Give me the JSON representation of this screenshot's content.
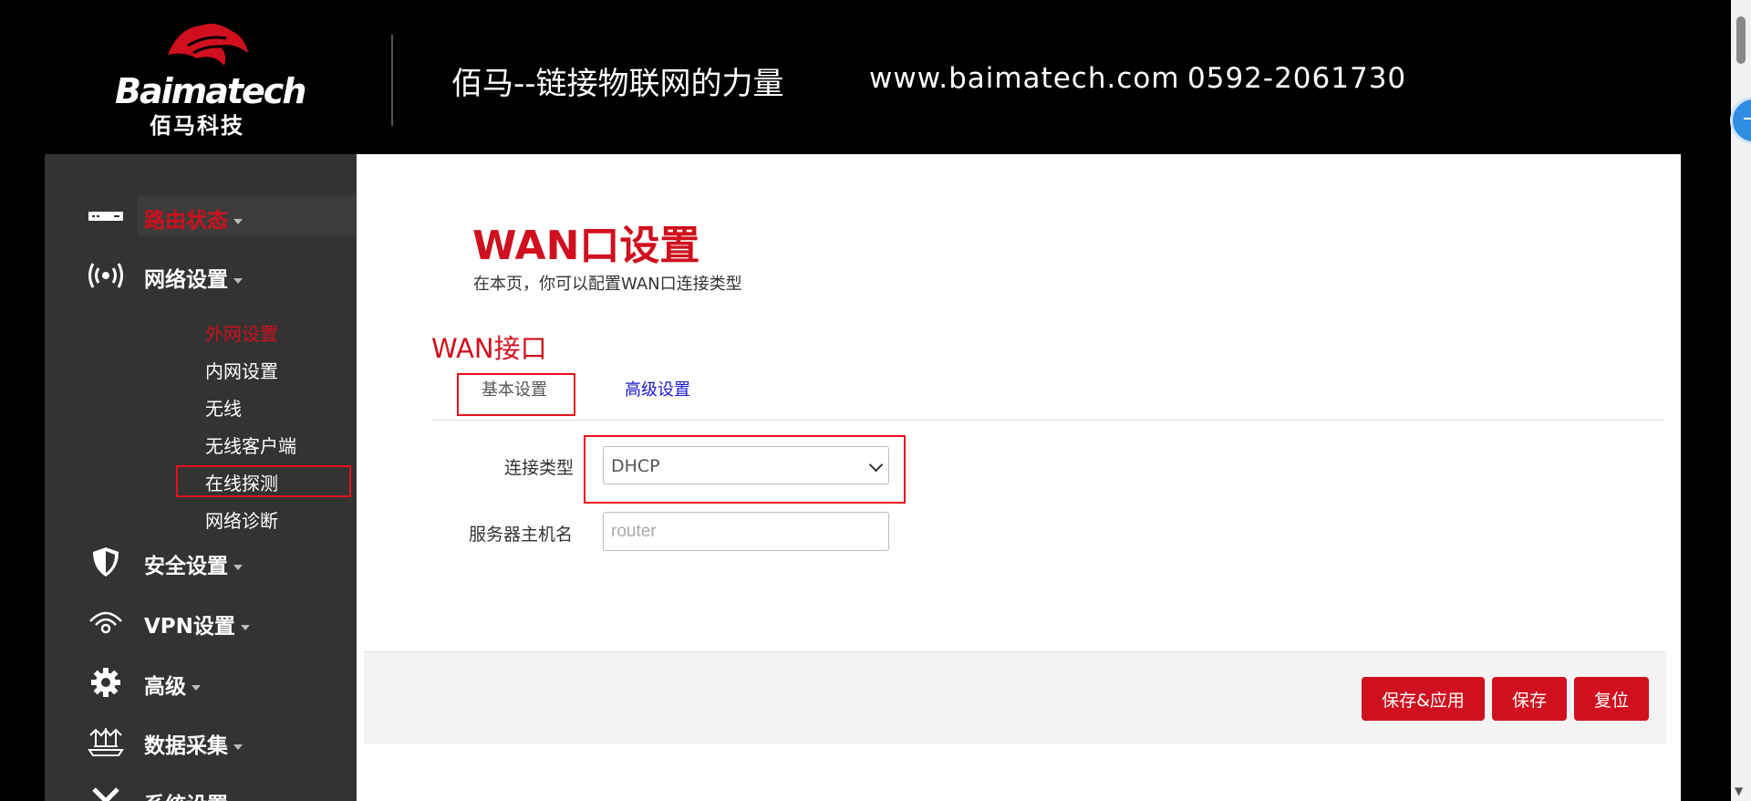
{
  "header": {
    "logo_text": "Baimatech",
    "logo_subtext": "佰马科技",
    "slogan": "佰马--链接物联网的力量",
    "website": "www.baimatech.com",
    "phone": "0592-2061730"
  },
  "sidebar": {
    "groups": [
      {
        "label": "路由状态",
        "icon": "router-icon",
        "active": true
      },
      {
        "label": "网络设置",
        "icon": "broadcast-icon"
      },
      {
        "label": "安全设置",
        "icon": "shield-icon"
      },
      {
        "label": "VPN设置",
        "icon": "vpn-icon"
      },
      {
        "label": "高级",
        "icon": "gear-icon"
      },
      {
        "label": "数据采集",
        "icon": "data-collect-icon"
      },
      {
        "label": "系统设置",
        "icon": "tools-icon"
      }
    ],
    "network_submenu": [
      {
        "label": "外网设置",
        "current": true
      },
      {
        "label": "内网设置"
      },
      {
        "label": "无线"
      },
      {
        "label": "无线客户端"
      },
      {
        "label": "在线探测"
      },
      {
        "label": "网络诊断"
      }
    ]
  },
  "main": {
    "title": "WAN口设置",
    "description": "在本页，你可以配置WAN口连接类型",
    "section_title": "WAN接口",
    "tabs": [
      {
        "label": "基本设置",
        "active": true
      },
      {
        "label": "高级设置"
      }
    ],
    "fields": {
      "connection_type": {
        "label": "连接类型",
        "value": "DHCP"
      },
      "hostname": {
        "label": "服务器主机名",
        "placeholder": "router"
      }
    },
    "buttons": {
      "save_apply": "保存&应用",
      "save": "保存",
      "reset": "复位"
    }
  },
  "colors": {
    "brand_red": "#d0101e",
    "highlight_box": "#e8101e",
    "sidebar_bg": "#333333",
    "link_blue": "#1a1ad0"
  }
}
